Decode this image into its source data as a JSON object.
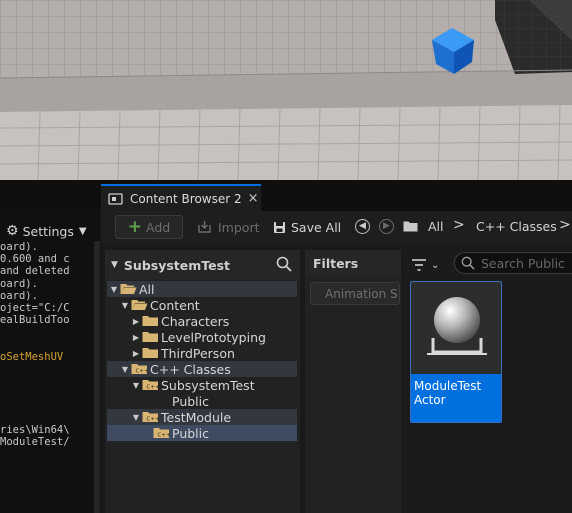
{
  "tab": {
    "label": "Content Browser 2",
    "close": "×"
  },
  "left_panel": {
    "settings_label": "Settings",
    "log_lines": [
      "oard).",
      "0.600 and c",
      "and deleted",
      "oard).",
      "oard).",
      "oject=\"C:/C",
      "ealBuildToo",
      "",
      "",
      "oSetMeshUV",
      "",
      "",
      "",
      "",
      "",
      "ries\\Win64\\",
      "ModuleTest/"
    ],
    "highlight_color": "#d7a22f"
  },
  "toolbar": {
    "add_label": "Add",
    "import_label": "Import",
    "save_all_label": "Save All",
    "breadcrumb": [
      "All",
      "C++ Classes"
    ],
    "separator": ">"
  },
  "sources": {
    "title": "SubsystemTest",
    "tree": [
      {
        "label": "All",
        "depth": 0,
        "expanded": true,
        "icon": "folder-open",
        "state": "hl"
      },
      {
        "label": "Content",
        "depth": 1,
        "expanded": true,
        "icon": "folder-open",
        "state": ""
      },
      {
        "label": "Characters",
        "depth": 2,
        "expanded": false,
        "icon": "folder",
        "state": ""
      },
      {
        "label": "LevelPrototyping",
        "depth": 2,
        "expanded": false,
        "icon": "folder",
        "state": ""
      },
      {
        "label": "ThirdPerson",
        "depth": 2,
        "expanded": false,
        "icon": "folder",
        "state": ""
      },
      {
        "label": "C++ Classes",
        "depth": 1,
        "expanded": true,
        "icon": "cpp-folder",
        "state": "hl"
      },
      {
        "label": "SubsystemTest",
        "depth": 2,
        "expanded": true,
        "icon": "cpp-folder",
        "state": ""
      },
      {
        "label": "Public",
        "depth": 3,
        "expanded": null,
        "icon": "none",
        "state": ""
      },
      {
        "label": "TestModule",
        "depth": 2,
        "expanded": true,
        "icon": "cpp-folder",
        "state": "hl"
      },
      {
        "label": "Public",
        "depth": 3,
        "expanded": null,
        "icon": "cpp-folder",
        "state": "sel"
      }
    ]
  },
  "filters": {
    "title": "Filters",
    "chip": "Animation S"
  },
  "assets": {
    "search_placeholder": "Search Public",
    "items": [
      {
        "name_line1": "ModuleTest",
        "name_line2": "Actor"
      }
    ]
  },
  "colors": {
    "accent": "#0070e0",
    "folder": "#d9b574",
    "panel": "#1a1a1a",
    "selection": "#3e4b61"
  }
}
